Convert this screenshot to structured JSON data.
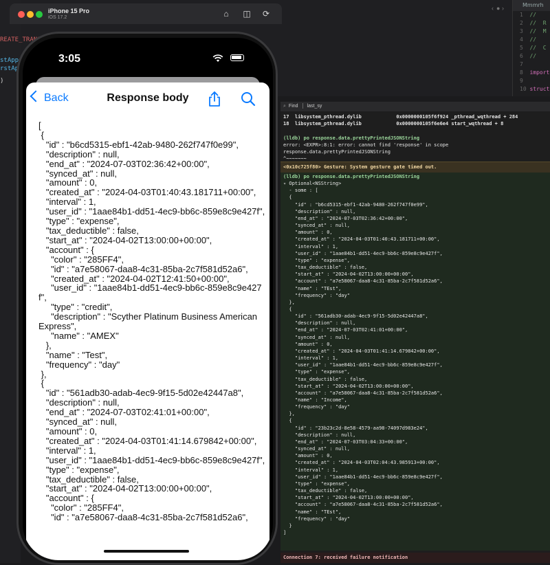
{
  "simulator": {
    "device_name": "iPhone 15 Pro",
    "os_version": "iOS 17.2",
    "status_time": "3:05"
  },
  "xcode": {
    "code_fragments": [
      "REATE_TRANS",
      "stAppe",
      "rstAp",
      ")"
    ],
    "right_tab": "Mmmrh",
    "right_lines": [
      {
        "n": "1",
        "t": "//"
      },
      {
        "n": "2",
        "t": "//  R"
      },
      {
        "n": "3",
        "t": "//  M"
      },
      {
        "n": "4",
        "t": "//"
      },
      {
        "n": "5",
        "t": "//  C"
      },
      {
        "n": "6",
        "t": "//"
      },
      {
        "n": "7",
        "t": ""
      },
      {
        "n": "8",
        "t": "import"
      },
      {
        "n": "9",
        "t": ""
      },
      {
        "n": "10",
        "t": "struct"
      }
    ]
  },
  "nav": {
    "back_label": "Back",
    "title": "Response body"
  },
  "response_body": "[\n {\n   \"id\" : \"b6cd5315-ebf1-42ab-9480-262f747f0e99\",\n   \"description\" : null,\n   \"end_at\" : \"2024-07-03T02:36:42+00:00\",\n   \"synced_at\" : null,\n   \"amount\" : 0,\n   \"created_at\" : \"2024-04-03T01:40:43.181711+00:00\",\n   \"interval\" : 1,\n   \"user_id\" : \"1aae84b1-dd51-4ec9-bb6c-859e8c9e427f\",\n   \"type\" : \"expense\",\n   \"tax_deductible\" : false,\n   \"start_at\" : \"2024-04-02T13:00:00+00:00\",\n   \"account\" : {\n     \"color\" : \"285FF4\",\n     \"id\" : \"a7e58067-daa8-4c31-85ba-2c7f581d52a6\",\n     \"created_at\" : \"2024-04-02T12:41:50+00:00\",\n     \"user_id\" : \"1aae84b1-dd51-4ec9-bb6c-859e8c9e427f\",\n     \"type\" : \"credit\",\n     \"description\" : \"Scyther Platinum Business American Express\",\n     \"name\" : \"AMEX\"\n   },\n   \"name\" : \"Test\",\n   \"frequency\" : \"day\"\n },\n {\n   \"id\" : \"561adb30-adab-4ec9-9f15-5d02e42447a8\",\n   \"description\" : null,\n   \"end_at\" : \"2024-07-03T02:41:01+00:00\",\n   \"synced_at\" : null,\n   \"amount\" : 0,\n   \"created_at\" : \"2024-04-03T01:41:14.679842+00:00\",\n   \"interval\" : 1,\n   \"user_id\" : \"1aae84b1-dd51-4ec9-bb6c-859e8c9e427f\",\n   \"type\" : \"expense\",\n   \"tax_deductible\" : false,\n   \"start_at\" : \"2024-04-02T13:00:00+00:00\",\n   \"account\" : {\n     \"color\" : \"285FF4\",\n     \"id\" : \"a7e58067-daa8-4c31-85ba-2c7f581d52a6\",",
  "console": {
    "find_label": "Find",
    "find_value": "last_sy",
    "backtrace": "17  libsystem_pthread.dylib            0x0000000105f6f924 _pthread_wqthread + 284\n18  libsystem_pthread.dylib            0x0000000105f6e6e4 start_wqthread + 8",
    "command1": "(lldb) po response.data.prettyPrintedJSONString",
    "error": "error: <EXPR>:8:1: error: cannot find 'response' in scope\nresponse.data.prettyPrintedJSONString\n^~~~~~~~",
    "gesture": "<0x10c725f80> Gesture: System gesture gate timed out.",
    "command2": "(lldb) po response.data.prettyPrintedJSONString",
    "output": "▿ Optional<NSString>\n  - some : [\n  {\n    \"id\" : \"b6cd5315-ebf1-42ab-9480-262f747f0e99\",\n    \"description\" : null,\n    \"end_at\" : \"2024-07-03T02:36:42+00:00\",\n    \"synced_at\" : null,\n    \"amount\" : 0,\n    \"created_at\" : \"2024-04-03T01:40:43.181711+00:00\",\n    \"interval\" : 1,\n    \"user_id\" : \"1aae84b1-dd51-4ec9-bb6c-859e8c9e427f\",\n    \"type\" : \"expense\",\n    \"tax_deductible\" : false,\n    \"start_at\" : \"2024-04-02T13:00:00+00:00\",\n    \"account\" : \"a7e58067-daa8-4c31-85ba-2c7f581d52a6\",\n    \"name\" : \"TEst\",\n    \"frequency\" : \"day\"\n  },\n  {\n    \"id\" : \"561adb30-adab-4ec9-9f15-5d02e42447a8\",\n    \"description\" : null,\n    \"end_at\" : \"2024-07-03T02:41:01+00:00\",\n    \"synced_at\" : null,\n    \"amount\" : 0,\n    \"created_at\" : \"2024-04-03T01:41:14.679842+00:00\",\n    \"interval\" : 1,\n    \"user_id\" : \"1aae84b1-dd51-4ec9-bb6c-859e8c9e427f\",\n    \"type\" : \"expense\",\n    \"tax_deductible\" : false,\n    \"start_at\" : \"2024-04-02T13:00:00+00:00\",\n    \"account\" : \"a7e58067-daa8-4c31-85ba-2c7f581d52a6\",\n    \"name\" : \"Income\",\n    \"frequency\" : \"day\"\n  },\n  {\n    \"id\" : \"23b23c2d-8e58-4579-aa98-74097d983e24\",\n    \"description\" : null,\n    \"end_at\" : \"2024-07-03T03:04:33+00:00\",\n    \"synced_at\" : null,\n    \"amount\" : 0,\n    \"created_at\" : \"2024-04-03T02:04:43.985913+00:00\",\n    \"interval\" : 1,\n    \"user_id\" : \"1aae84b1-dd51-4ec9-bb6c-859e8c9e427f\",\n    \"type\" : \"expense\",\n    \"tax_deductible\" : false,\n    \"start_at\" : \"2024-04-02T13:00:00+00:00\",\n    \"account\" : \"a7e58067-daa8-4c31-85ba-2c7f581d52a6\",\n    \"name\" : \"TEst\",\n    \"frequency\" : \"day\"\n  }\n]",
    "connection": "Connection 7: received failure notification"
  },
  "colors": {
    "accent": "#0a7aff",
    "traffic_red": "#ff5f57",
    "traffic_yellow": "#febc2e",
    "traffic_green": "#28c840"
  }
}
